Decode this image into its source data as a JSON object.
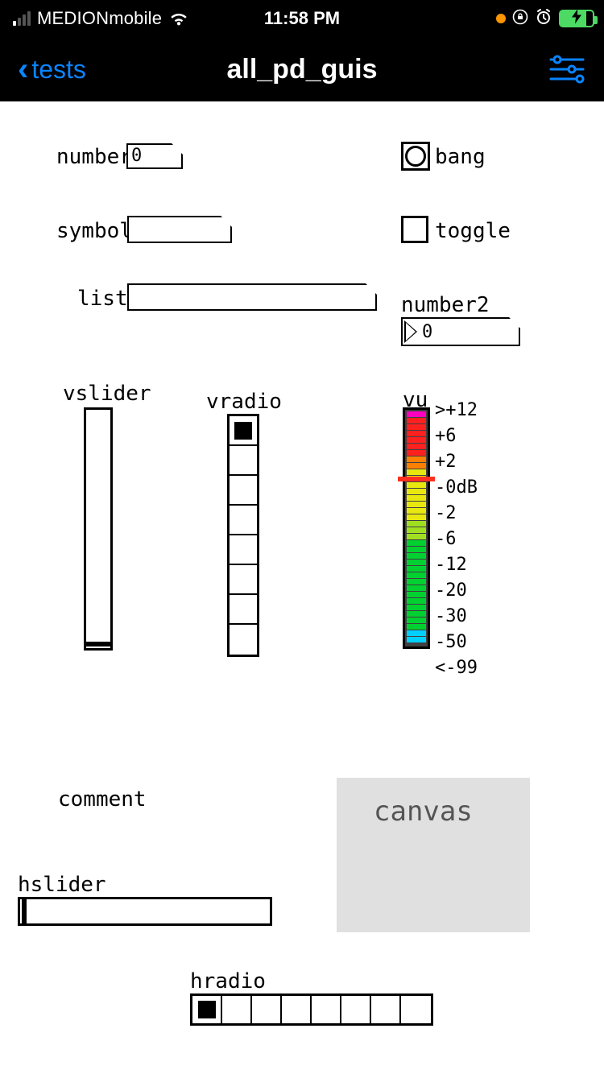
{
  "status": {
    "carrier": "MEDIONmobile",
    "time": "11:58 PM"
  },
  "nav": {
    "back_label": "tests",
    "title": "all_pd_guis"
  },
  "labels": {
    "number": "number",
    "bang": "bang",
    "symbol": "symbol",
    "toggle": "toggle",
    "list": "list",
    "number2": "number2",
    "vslider": "vslider",
    "vradio": "vradio",
    "vu": "vu",
    "comment": "comment",
    "canvas": "canvas",
    "hslider": "hslider",
    "hradio": "hradio"
  },
  "values": {
    "number": "0",
    "number2": "0"
  },
  "vu_scale": [
    ">+12",
    "+6",
    "+2",
    "-0dB",
    "-2",
    "-6",
    "-12",
    "-20",
    "-30",
    "-50",
    "<-99"
  ],
  "vu_colors": {
    "magenta": "#ff00c0",
    "red": "#ff2020",
    "orange": "#ff8000",
    "yellow": "#e8e810",
    "yellowgreen": "#a0e020",
    "green": "#00d030",
    "cyan": "#00d0ff"
  },
  "vradio_count": 8,
  "vradio_selected": 0,
  "hradio_count": 8,
  "hradio_selected": 0
}
